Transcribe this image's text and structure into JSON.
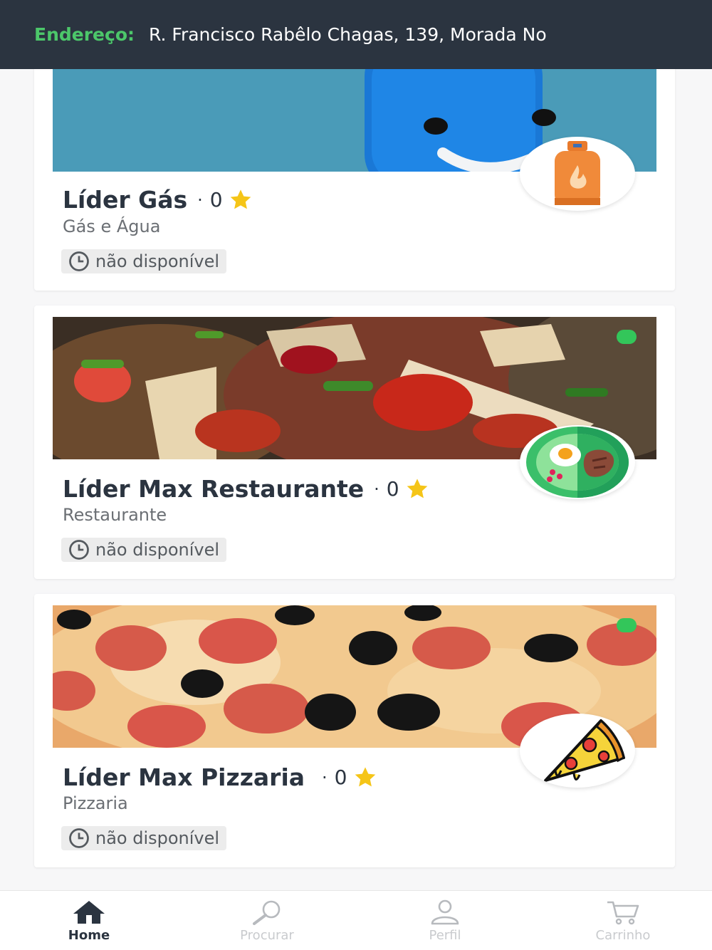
{
  "header": {
    "address_label": "Endereço:",
    "address_value": "R. Francisco Rabêlo Chagas, 139, Morada No"
  },
  "stores": [
    {
      "name": "Líder Gás",
      "separator": "·",
      "rating": "0",
      "category": "Gás e Água",
      "status": "não disponível",
      "logo_icon": "gas-cylinder-icon",
      "online": false
    },
    {
      "name": "Líder Max Restaurante",
      "separator": "·",
      "rating": "0",
      "category": "Restaurante",
      "status": "não disponível",
      "logo_icon": "meal-plate-icon",
      "online": true
    },
    {
      "name": "Líder Max Pizzaria",
      "separator": "·",
      "rating": "0",
      "category": "Pizzaria",
      "status": "não disponível",
      "logo_icon": "pizza-slice-icon",
      "online": true
    }
  ],
  "nav": [
    {
      "label": "Home",
      "icon": "home-icon",
      "active": true
    },
    {
      "label": "Procurar",
      "icon": "search-icon",
      "active": false
    },
    {
      "label": "Perfil",
      "icon": "user-icon",
      "active": false
    },
    {
      "label": "Carrinho",
      "icon": "cart-icon",
      "active": false
    }
  ],
  "colors": {
    "header_bg": "#2b3440",
    "accent_green": "#4cc76a",
    "star": "#f5c518",
    "online": "#33c65a"
  }
}
